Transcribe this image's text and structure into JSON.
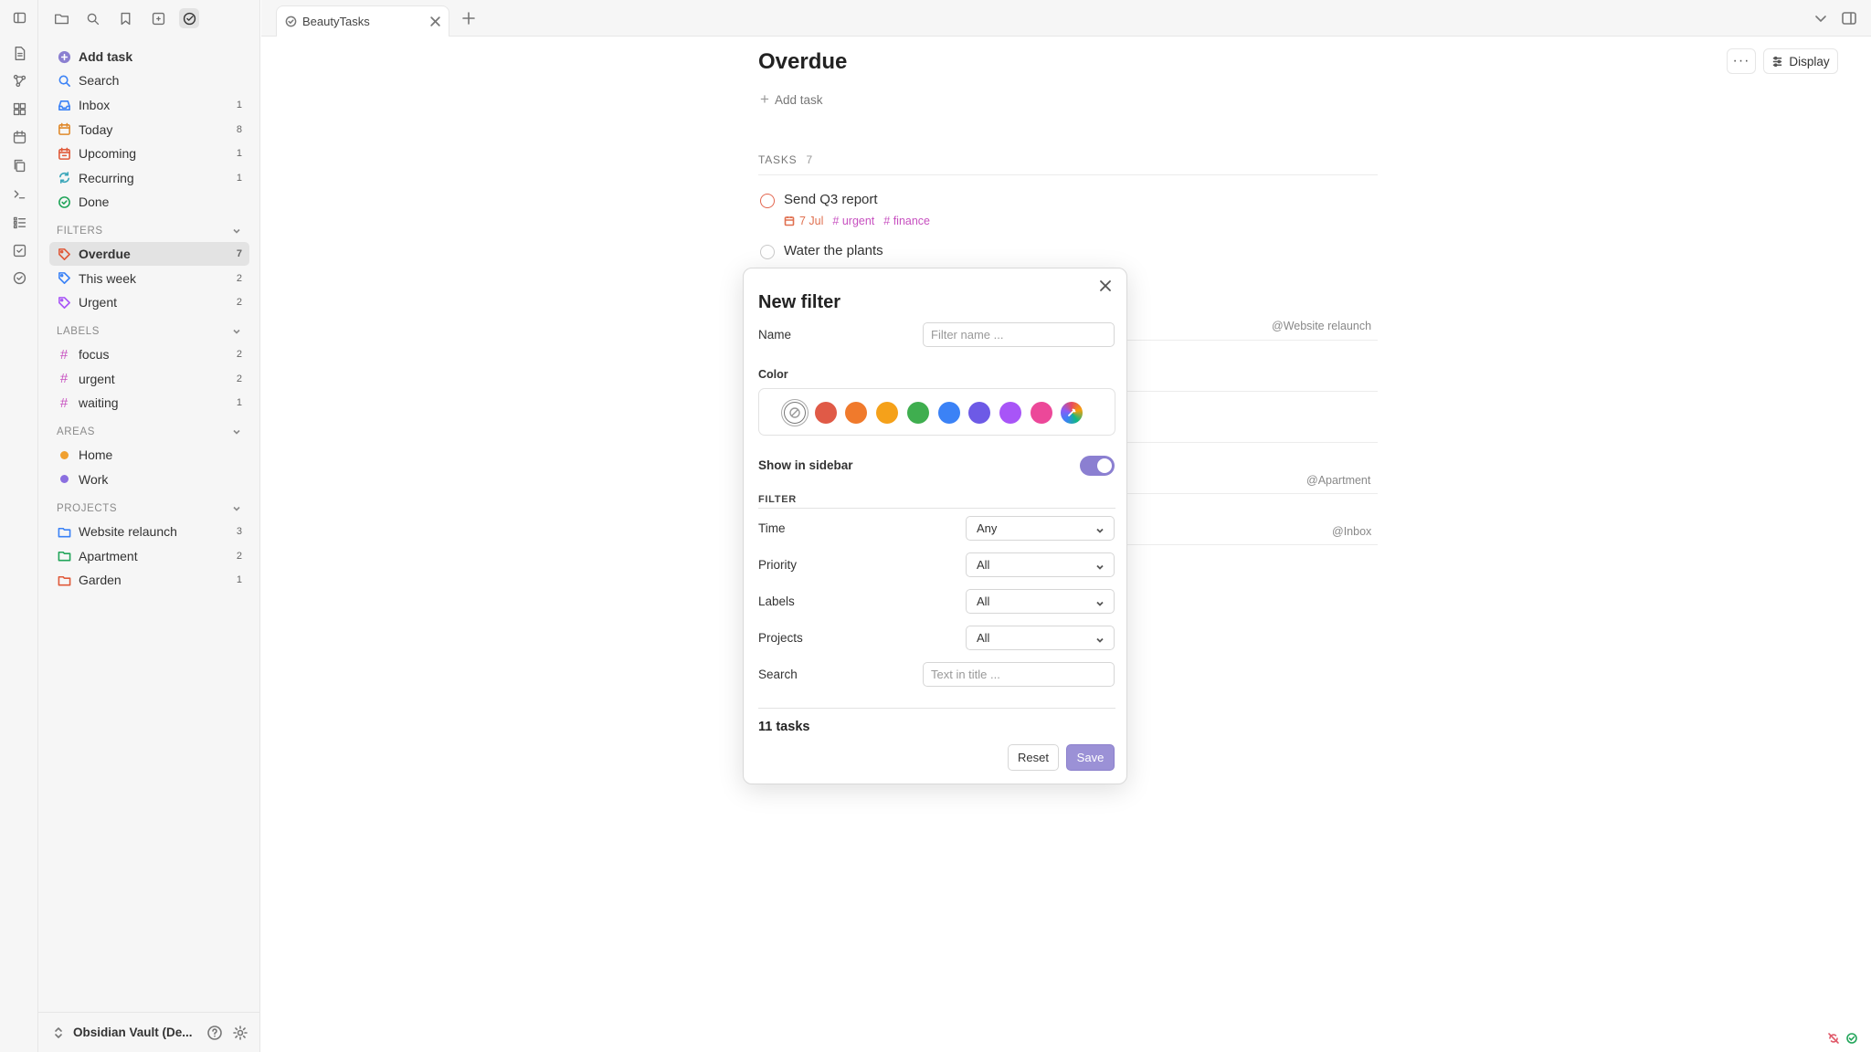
{
  "app": {
    "tab_title": "BeautyTasks",
    "page_title": "Overdue",
    "add_task": "Add task",
    "more_label": "···",
    "display_label": "Display"
  },
  "sidebar": {
    "add_task": "Add task",
    "search": "Search",
    "nav": [
      {
        "label": "Inbox",
        "count": "1",
        "color": "#3b82f6",
        "icon": "inbox-icon"
      },
      {
        "label": "Today",
        "count": "8",
        "color": "#e08a2c",
        "icon": "calendar-today-icon"
      },
      {
        "label": "Upcoming",
        "count": "1",
        "color": "#e05a3a",
        "icon": "calendar-upcoming-icon"
      },
      {
        "label": "Recurring",
        "count": "1",
        "color": "#3aa6b9",
        "icon": "recurring-icon"
      },
      {
        "label": "Done",
        "count": "",
        "color": "#22a55a",
        "icon": "check-circle-icon"
      }
    ],
    "filters_head": "FILTERS",
    "filters": [
      {
        "label": "Overdue",
        "count": "7",
        "color": "#e05a3a"
      },
      {
        "label": "This week",
        "count": "2",
        "color": "#3b82f6"
      },
      {
        "label": "Urgent",
        "count": "2",
        "color": "#a855f7"
      }
    ],
    "labels_head": "LABELS",
    "labels": [
      {
        "label": "focus",
        "count": "2",
        "color": "#c750c0"
      },
      {
        "label": "urgent",
        "count": "2",
        "color": "#c750c0"
      },
      {
        "label": "waiting",
        "count": "1",
        "color": "#c750c0"
      }
    ],
    "areas_head": "AREAS",
    "areas": [
      {
        "label": "Home",
        "color": "#f0a030"
      },
      {
        "label": "Work",
        "color": "#8b6fe0"
      }
    ],
    "projects_head": "PROJECTS",
    "projects": [
      {
        "label": "Website relaunch",
        "count": "3",
        "color": "#3b82f6"
      },
      {
        "label": "Apartment",
        "count": "2",
        "color": "#22a55a"
      },
      {
        "label": "Garden",
        "count": "1",
        "color": "#e05a3a"
      }
    ],
    "vault_name": "Obsidian Vault (De..."
  },
  "tasks": {
    "header": "TASKS",
    "count": "7",
    "items": [
      {
        "title": "Send Q3 report",
        "date": "7 Jul",
        "labels": [
          "# urgent",
          "# finance"
        ]
      },
      {
        "title": "Water the plants"
      }
    ],
    "project_refs": [
      "@Website relaunch",
      "@Apartment",
      "@Inbox"
    ]
  },
  "modal": {
    "title": "New filter",
    "name_label": "Name",
    "name_placeholder": "Filter name ...",
    "color_label": "Color",
    "colors": [
      "none",
      "#e05a47",
      "#f07a2c",
      "#f5a11a",
      "#3fae4f",
      "#3b82f6",
      "#6d5ae6",
      "#a855f7",
      "#ec4899",
      "custom"
    ],
    "show_sidebar_label": "Show in sidebar",
    "show_sidebar_on": true,
    "filter_section": "FILTER",
    "time_label": "Time",
    "time_value": "Any",
    "priority_label": "Priority",
    "priority_value": "All",
    "labels_label": "Labels",
    "labels_value": "All",
    "projects_label": "Projects",
    "projects_value": "All",
    "search_label": "Search",
    "search_placeholder": "Text in title ...",
    "count_text": "11 tasks",
    "reset_label": "Reset",
    "save_label": "Save"
  }
}
